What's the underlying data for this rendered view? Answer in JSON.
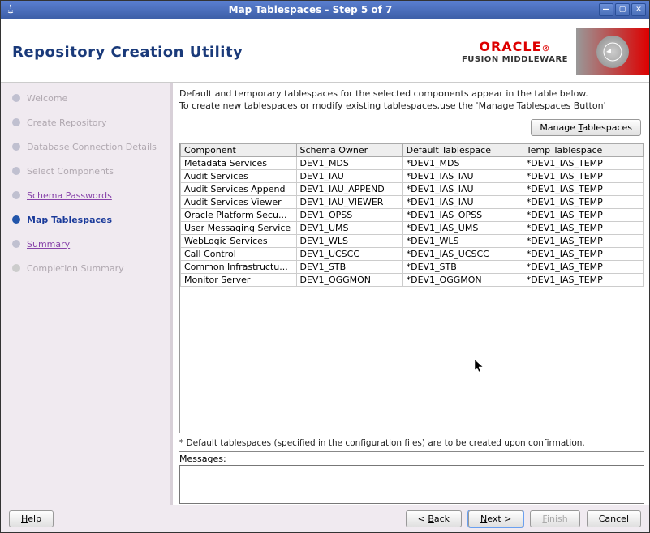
{
  "window": {
    "title": "Map Tablespaces - Step 5 of 7"
  },
  "header": {
    "app_title": "Repository Creation Utility",
    "brand_top": "ORACLE",
    "brand_bottom": "FUSION MIDDLEWARE"
  },
  "sidebar": {
    "steps": [
      {
        "label": "Welcome",
        "state": "done"
      },
      {
        "label": "Create Repository",
        "state": "done"
      },
      {
        "label": "Database Connection Details",
        "state": "done"
      },
      {
        "label": "Select Components",
        "state": "done"
      },
      {
        "label": "Schema Passwords",
        "state": "link"
      },
      {
        "label": "Map Tablespaces",
        "state": "current"
      },
      {
        "label": "Summary",
        "state": "link"
      },
      {
        "label": "Completion Summary",
        "state": "pending"
      }
    ]
  },
  "content": {
    "instruction_line1": "Default and temporary tablespaces for the selected components appear in the table below.",
    "instruction_line2": "To create new tablespaces or modify existing tablespaces,use the 'Manage Tablespaces Button'",
    "manage_btn_pre": "Manage ",
    "manage_btn_u": "T",
    "manage_btn_post": "ablespaces",
    "columns": {
      "c1": "Component",
      "c2": "Schema Owner",
      "c3": "Default Tablespace",
      "c4": "Temp Tablespace"
    },
    "rows": [
      {
        "c1": "Metadata Services",
        "c2": "DEV1_MDS",
        "c3": "*DEV1_MDS",
        "c4": "*DEV1_IAS_TEMP"
      },
      {
        "c1": "Audit Services",
        "c2": "DEV1_IAU",
        "c3": "*DEV1_IAS_IAU",
        "c4": "*DEV1_IAS_TEMP"
      },
      {
        "c1": "Audit Services Append",
        "c2": "DEV1_IAU_APPEND",
        "c3": "*DEV1_IAS_IAU",
        "c4": "*DEV1_IAS_TEMP"
      },
      {
        "c1": "Audit Services Viewer",
        "c2": "DEV1_IAU_VIEWER",
        "c3": "*DEV1_IAS_IAU",
        "c4": "*DEV1_IAS_TEMP"
      },
      {
        "c1": "Oracle Platform Secu...",
        "c2": "DEV1_OPSS",
        "c3": "*DEV1_IAS_OPSS",
        "c4": "*DEV1_IAS_TEMP"
      },
      {
        "c1": "User Messaging Service",
        "c2": "DEV1_UMS",
        "c3": "*DEV1_IAS_UMS",
        "c4": "*DEV1_IAS_TEMP"
      },
      {
        "c1": "WebLogic Services",
        "c2": "DEV1_WLS",
        "c3": "*DEV1_WLS",
        "c4": "*DEV1_IAS_TEMP"
      },
      {
        "c1": "Call Control",
        "c2": "DEV1_UCSCC",
        "c3": "*DEV1_IAS_UCSCC",
        "c4": "*DEV1_IAS_TEMP"
      },
      {
        "c1": "Common Infrastructu...",
        "c2": "DEV1_STB",
        "c3": "*DEV1_STB",
        "c4": "*DEV1_IAS_TEMP"
      },
      {
        "c1": "Monitor Server",
        "c2": "DEV1_OGGMON",
        "c3": "*DEV1_OGGMON",
        "c4": "*DEV1_IAS_TEMP"
      }
    ],
    "footnote": "* Default tablespaces (specified in the configuration files) are to be created upon confirmation.",
    "messages_label_pre": "M",
    "messages_label_post": "essages:"
  },
  "footer": {
    "help_u": "H",
    "help_post": "elp",
    "back_pre": "< ",
    "back_u": "B",
    "back_post": "ack",
    "next_u": "N",
    "next_post": "ext >",
    "finish_u": "F",
    "finish_post": "inish",
    "cancel": "Cancel"
  }
}
